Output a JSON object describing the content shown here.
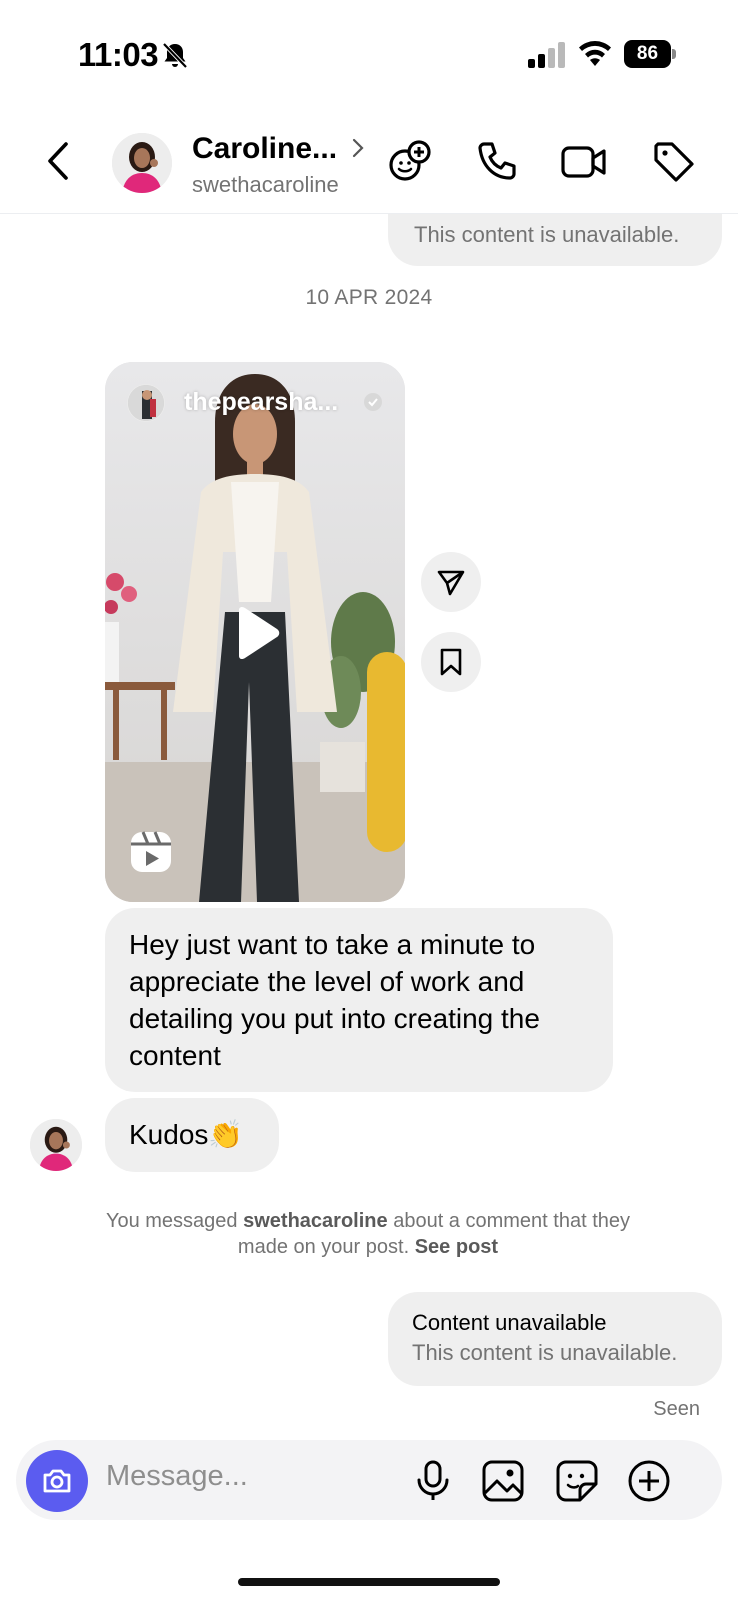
{
  "status_bar": {
    "time": "11:03",
    "battery": "86"
  },
  "header": {
    "contact_name": "Caroline...",
    "contact_handle": "swethacaroline"
  },
  "chat": {
    "top_partial_text": "This content is unavailable.",
    "date_separator": "10 APR 2024",
    "reel": {
      "username": "thepearsha..."
    },
    "message": "Hey just want to take a minute to appreciate the level of work and detailing you put into creating the content",
    "kudos": "Kudos👏",
    "notice": {
      "prefix": "You messaged",
      "user": "swethacaroline",
      "middle": "about a comment that they made on your post.",
      "link": "See post"
    },
    "outgoing": {
      "title": "Content unavailable",
      "subtitle": "This content is unavailable."
    },
    "seen": "Seen"
  },
  "composer": {
    "placeholder": "Message..."
  },
  "colors": {
    "accent": "#5b5cf0",
    "bubble": "#efefef",
    "muted": "#737373"
  },
  "icons": [
    "bell-off-icon",
    "signal-icon",
    "wifi-icon",
    "back-icon",
    "add-effect-icon",
    "phone-icon",
    "video-icon",
    "tag-icon",
    "send-icon",
    "bookmark-icon",
    "play-icon",
    "reels-icon",
    "camera-icon",
    "mic-icon",
    "gallery-icon",
    "sticker-icon",
    "plus-circle-icon"
  ]
}
